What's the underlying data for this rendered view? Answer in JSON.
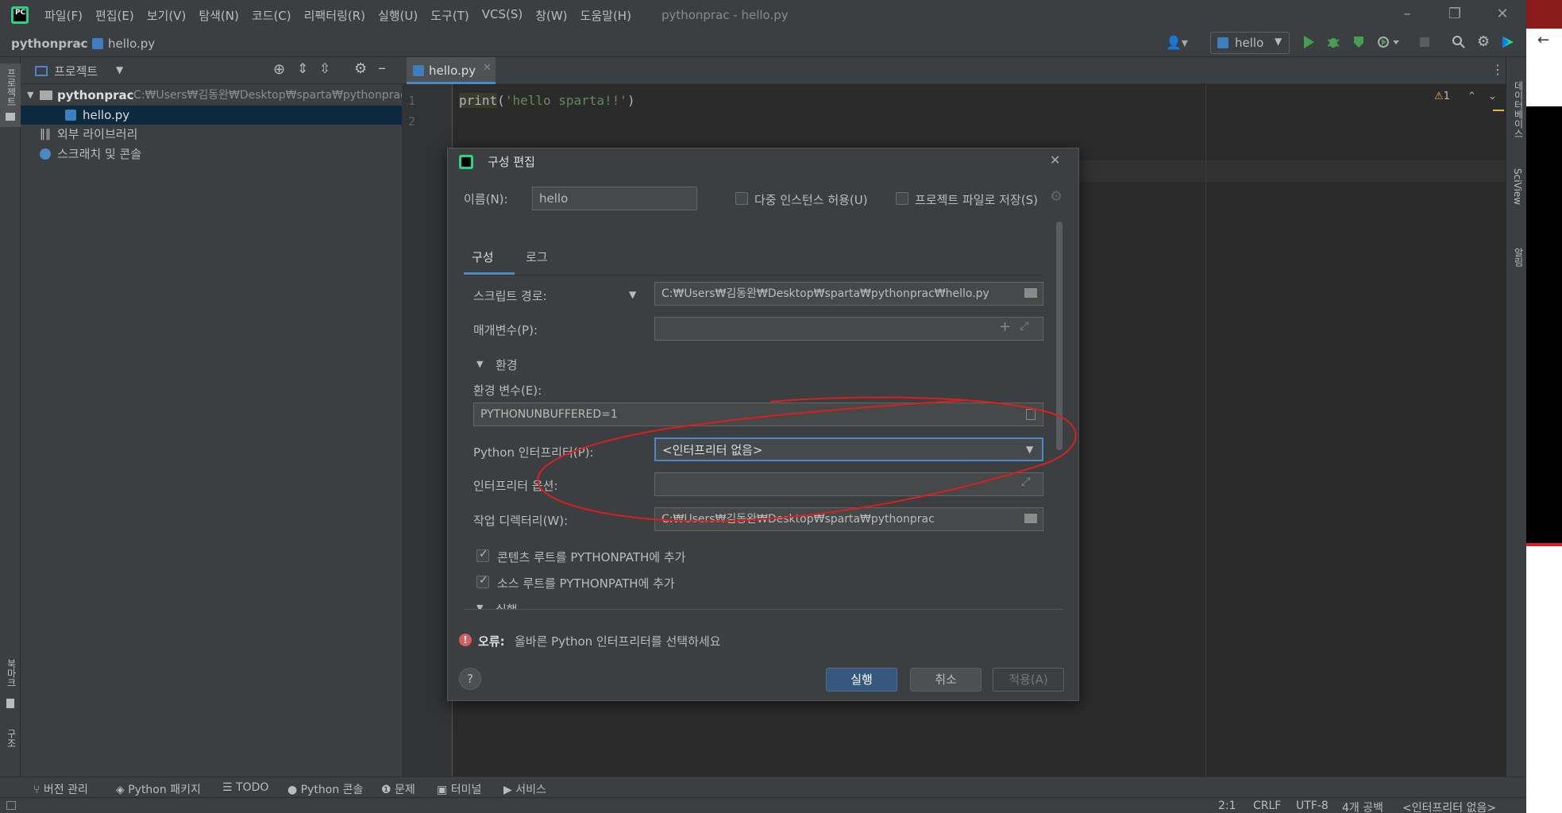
{
  "app": {
    "logo_text": "PC",
    "title": "pythonprac - hello.py",
    "menu": [
      "파일(F)",
      "편집(E)",
      "보기(V)",
      "탐색(N)",
      "코드(C)",
      "리팩터링(R)",
      "실행(U)",
      "도구(T)",
      "VCS(S)",
      "창(W)",
      "도움말(H)"
    ]
  },
  "navbar": {
    "project": "pythonprac",
    "file": "hello.py",
    "run_config": "hello"
  },
  "left_stripe": {
    "project_tab": "프로젝트",
    "bookmarks_tab": "북마크",
    "structure_tab": "구조"
  },
  "project_panel": {
    "title": "프로젝트",
    "root_name": "pythonprac",
    "root_path": "C:₩Users₩김동완₩Desktop₩sparta₩pythonprac",
    "file": "hello.py",
    "external_libs": "외부 라이브러리",
    "scratches": "스크래치 및 콘솔"
  },
  "editor": {
    "tab": "hello.py",
    "lines": [
      "1",
      "2"
    ],
    "code_func": "print",
    "code_open": "(",
    "code_str": "'hello sparta!!'",
    "code_close": ")",
    "warning_count": "1"
  },
  "right_stripe": {
    "database_tab": "데이터베이스",
    "sciview_tab": "SciView",
    "notifications_tab": "알림"
  },
  "dialog": {
    "title": "구성 편집",
    "name_label": "이름(N):",
    "name_value": "hello",
    "allow_parallel": "다중 인스턴스 허용(U)",
    "store_project": "프로젝트 파일로 저장(S)",
    "tabs": [
      "구성",
      "로그"
    ],
    "script_label": "스크립트 경로:",
    "script_value": "C:₩Users₩김동완₩Desktop₩sparta₩pythonprac₩hello.py",
    "params_label": "매개변수(P):",
    "env_section": "환경",
    "env_vars_label": "환경 변수(E):",
    "env_vars_value": "PYTHONUNBUFFERED=1",
    "interpreter_label": "Python 인터프리터(P):",
    "interpreter_value": "<인터프리터 없음>",
    "interp_options_label": "인터프리터 옵션:",
    "workdir_label": "작업 디렉터리(W):",
    "workdir_value": "C:₩Users₩김동완₩Desktop₩sparta₩pythonprac",
    "add_content_roots": "콘텐츠 루트를 PYTHONPATH에 추가",
    "add_source_roots": "소스 루트를 PYTHONPATH에 추가",
    "exec_section": "실행",
    "error_prefix": "오류:",
    "error_text": "올바른 Python 인터프리터를 선택하세요",
    "help": "?",
    "run_btn": "실행",
    "cancel_btn": "취소",
    "apply_btn": "적용(A)"
  },
  "bottom_tools": [
    "버전 관리",
    "Python 패키지",
    "TODO",
    "Python 콘솔",
    "문제",
    "터미널",
    "서비스"
  ],
  "status": {
    "position": "2:1",
    "line_sep": "CRLF",
    "encoding": "UTF-8",
    "indent": "4개 공백",
    "interpreter": "<인터프리터 없음>"
  },
  "colors": {
    "accent": "#4a88c7",
    "annotation": "#d91f1f",
    "error": "#db5c5c",
    "run_green": "#499c54"
  }
}
